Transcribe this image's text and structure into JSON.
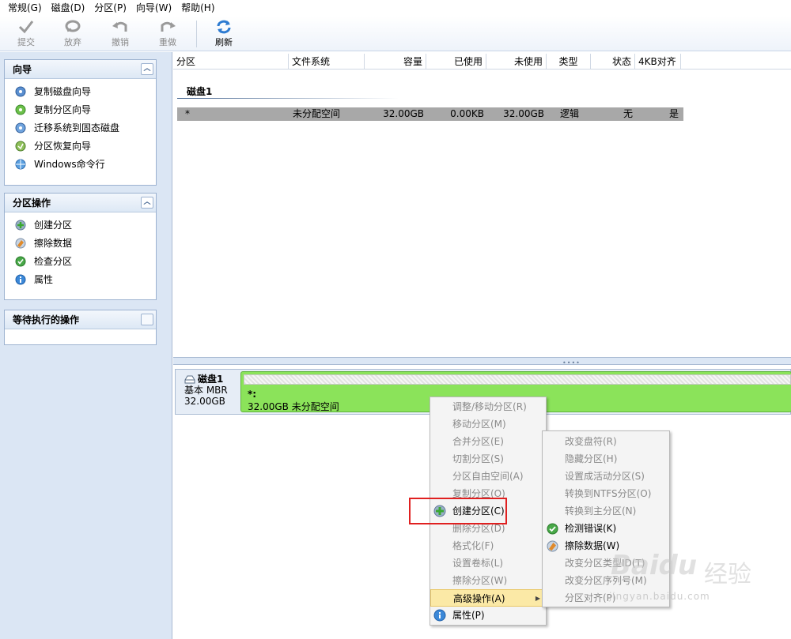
{
  "menu": [
    "常规(G)",
    "磁盘(D)",
    "分区(P)",
    "向导(W)",
    "帮助(H)"
  ],
  "toolbar": {
    "submit": "提交",
    "discard": "放弃",
    "undo": "撤销",
    "redo": "重做",
    "refresh": "刷新"
  },
  "wizard_panel": {
    "title": "向导",
    "items": [
      "复制磁盘向导",
      "复制分区向导",
      "迁移系统到固态磁盘",
      "分区恢复向导",
      "Windows命令行"
    ]
  },
  "ops_panel": {
    "title": "分区操作",
    "items": [
      "创建分区",
      "擦除数据",
      "检查分区",
      "属性"
    ]
  },
  "pending_panel": {
    "title": "等待执行的操作"
  },
  "table": {
    "columns": [
      "分区",
      "文件系统",
      "容量",
      "已使用",
      "未使用",
      "类型",
      "状态",
      "4KB对齐"
    ],
    "disk_title": "磁盘1",
    "rows": [
      {
        "partition": "*",
        "fs": "未分配空间",
        "capacity": "32.00GB",
        "used": "0.00KB",
        "unused": "32.00GB",
        "type": "逻辑",
        "status": "无",
        "align": "是"
      }
    ]
  },
  "disk_map": {
    "name": "磁盘1",
    "kind": "基本 MBR",
    "size": "32.00GB",
    "partition_label": "*:",
    "partition_desc": "32.00GB 未分配空间"
  },
  "context_menu": {
    "items": [
      {
        "label": "调整/移动分区(R)",
        "enabled": false
      },
      {
        "label": "移动分区(M)",
        "enabled": false
      },
      {
        "label": "合并分区(E)",
        "enabled": false
      },
      {
        "label": "切割分区(S)",
        "enabled": false
      },
      {
        "label": "分区自由空间(A)",
        "enabled": false
      },
      {
        "label": "复制分区(O)",
        "enabled": false
      },
      {
        "label": "创建分区(C)",
        "enabled": true
      },
      {
        "label": "删除分区(D)",
        "enabled": false
      },
      {
        "label": "格式化(F)",
        "enabled": false
      },
      {
        "label": "设置卷标(L)",
        "enabled": false
      },
      {
        "label": "擦除分区(W)",
        "enabled": false
      },
      {
        "label": "高级操作(A)",
        "enabled": true
      },
      {
        "label": "属性(P)",
        "enabled": true
      }
    ]
  },
  "submenu": {
    "items": [
      {
        "label": "改变盘符(R)",
        "enabled": false
      },
      {
        "label": "隐藏分区(H)",
        "enabled": false
      },
      {
        "label": "设置成活动分区(S)",
        "enabled": false
      },
      {
        "label": "转换到NTFS分区(O)",
        "enabled": false
      },
      {
        "label": "转换到主分区(N)",
        "enabled": false
      },
      {
        "label": "检测错误(K)",
        "enabled": true
      },
      {
        "label": "擦除数据(W)",
        "enabled": true
      },
      {
        "label": "改变分区类型ID(T)",
        "enabled": false
      },
      {
        "label": "改变分区序列号(M)",
        "enabled": false
      },
      {
        "label": "分区对齐(P)",
        "enabled": false
      }
    ]
  },
  "watermark": {
    "brand": "Baidu",
    "brand_cn": "经验",
    "url": "jingyan.baidu.com"
  },
  "colors": {
    "unallocated": "#8be35a",
    "highlight": "#fbe9a6",
    "annotation": "#e02020",
    "panel_bg": "#dbe6f4"
  }
}
